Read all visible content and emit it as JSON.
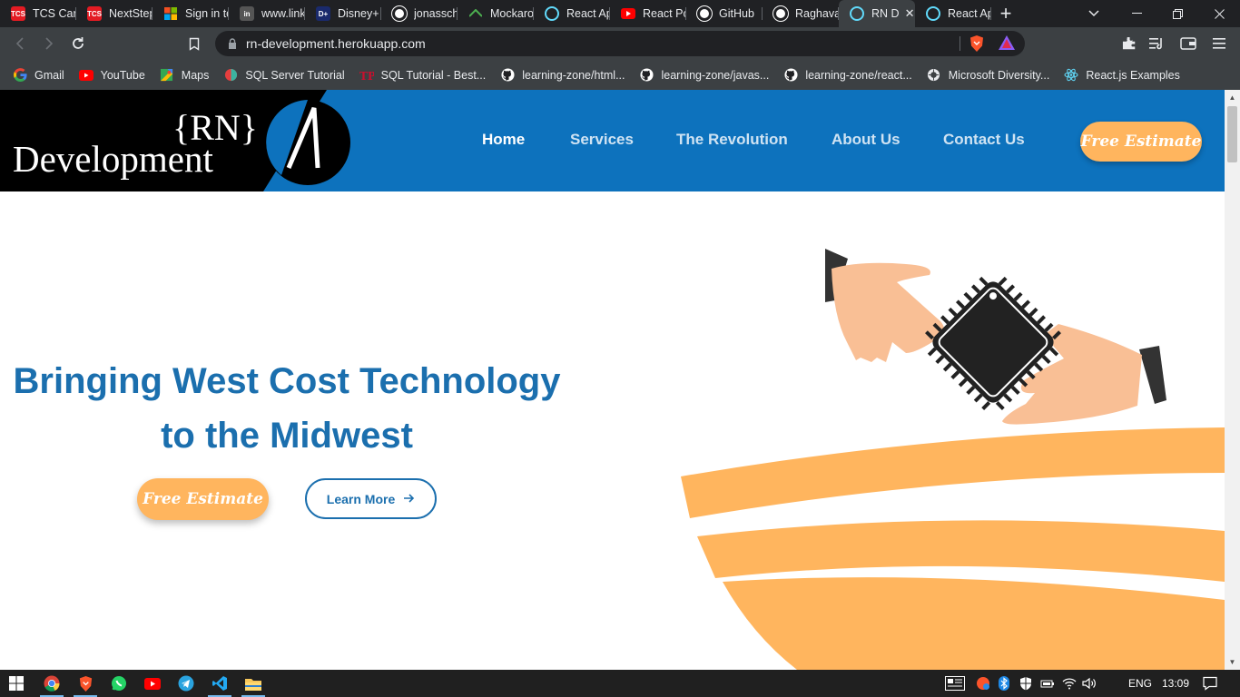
{
  "browser": {
    "tabs": [
      {
        "title": "TCS Caree",
        "icon": "tcs-icon",
        "color": "#e31b23",
        "badge": "TCS"
      },
      {
        "title": "NextStep",
        "icon": "tcs-icon",
        "color": "#e31b23",
        "badge": "TCS"
      },
      {
        "title": "Sign in to",
        "icon": "microsoft-icon",
        "color": "#f25022",
        "badge": ""
      },
      {
        "title": "www.link",
        "icon": "linkedin-icon",
        "color": "#555",
        "badge": "in"
      },
      {
        "title": "Disney+",
        "icon": "disney-icon",
        "color": "#1a2a6c",
        "badge": "D+"
      },
      {
        "title": "jonasschr",
        "icon": "github-icon",
        "color": "#202124",
        "badge": ""
      },
      {
        "title": "Mockaro",
        "icon": "mockaroo-icon",
        "color": "#202124",
        "badge": ""
      },
      {
        "title": "React Ap",
        "icon": "react-icon",
        "color": "#202124",
        "badge": ""
      },
      {
        "title": "React Po",
        "icon": "youtube-icon",
        "color": "#ff0000",
        "badge": ""
      },
      {
        "title": "GitHub",
        "icon": "github-icon",
        "color": "#202124",
        "badge": ""
      },
      {
        "title": "Raghava",
        "icon": "github-icon",
        "color": "#202124",
        "badge": ""
      },
      {
        "title": "RN D",
        "icon": "react-icon",
        "color": "#202124",
        "badge": "",
        "active": true
      },
      {
        "title": "React Ap",
        "icon": "react-icon",
        "color": "#202124",
        "badge": ""
      }
    ],
    "address": "rn-development.herokuapp.com",
    "bookmarks": [
      {
        "label": "Gmail",
        "icon": "google-icon"
      },
      {
        "label": "YouTube",
        "icon": "youtube-icon"
      },
      {
        "label": "Maps",
        "icon": "maps-icon"
      },
      {
        "label": "SQL Server Tutorial",
        "icon": "sqlserver-icon"
      },
      {
        "label": "SQL Tutorial - Best...",
        "icon": "tp-icon"
      },
      {
        "label": "learning-zone/html...",
        "icon": "github-icon"
      },
      {
        "label": "learning-zone/javas...",
        "icon": "github-icon"
      },
      {
        "label": "learning-zone/react...",
        "icon": "github-icon"
      },
      {
        "label": "Microsoft Diversity...",
        "icon": "globe-icon"
      },
      {
        "label": "React.js Examples",
        "icon": "react-icon"
      }
    ]
  },
  "site": {
    "logo": {
      "top": "{RN}",
      "bottom": "Development"
    },
    "nav": [
      "Home",
      "Services",
      "The Revolution",
      "About Us",
      "Contact Us"
    ],
    "header_cta": "Free Estimate",
    "hero": {
      "line1": "Bringing West Cost Technology",
      "line2": "to the Midwest",
      "cta": "Free Estimate",
      "learn_more": "Learn More"
    },
    "colors": {
      "primary": "#0d72bd",
      "accent": "#ffb55e",
      "heading": "#1b6fae"
    }
  },
  "taskbar": {
    "language": "ENG",
    "time": "13:09"
  }
}
